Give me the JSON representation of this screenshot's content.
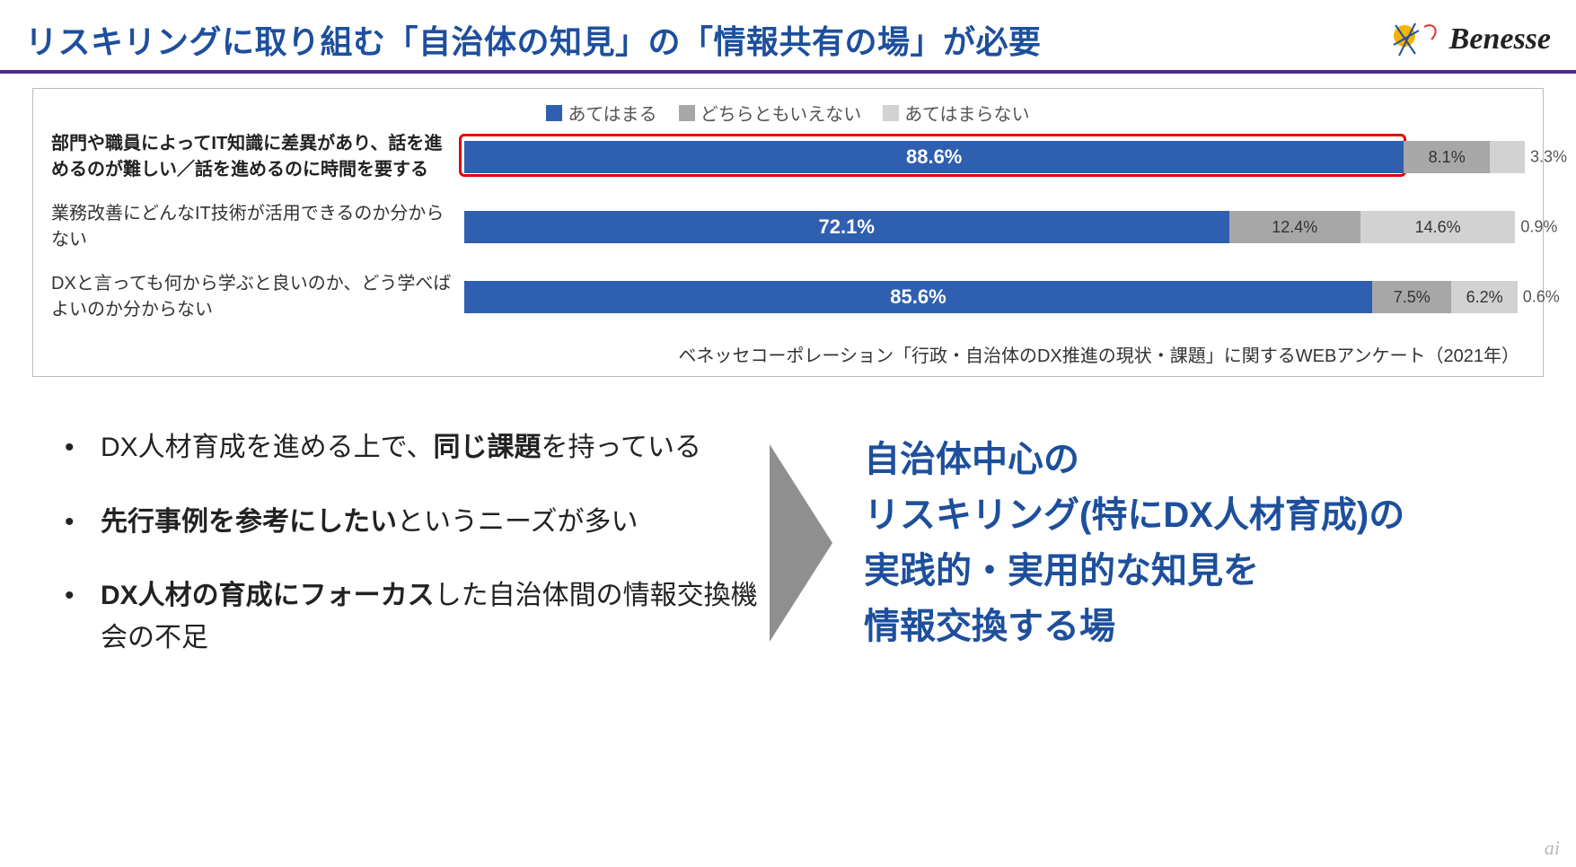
{
  "header": {
    "title": "リスキリングに取り組む「自治体の知見」の「情報共有の場」が必要",
    "brand": "Benesse"
  },
  "chart_data": {
    "type": "bar",
    "orientation": "horizontal-stacked",
    "unit": "%",
    "legend": [
      "あてはまる",
      "どちらともいえない",
      "あてはまらない"
    ],
    "categories": [
      "部門や職員によってIT知識に差異があり、話を進めるのが難しい／話を進めるのに時間を要する",
      "業務改善にどんなIT技術が活用できるのか分からない",
      "DXと言っても何から学ぶと良いのか、どう学べばよいのか分からない"
    ],
    "series": [
      {
        "name": "あてはまる",
        "values": [
          88.6,
          72.1,
          85.6
        ]
      },
      {
        "name": "どちらともいえない",
        "values": [
          8.1,
          12.4,
          7.5
        ]
      },
      {
        "name": "あてはまらない",
        "values": [
          3.3,
          14.6,
          6.2
        ]
      }
    ],
    "overflow_labels": [
      null,
      "0.9%",
      "0.6%"
    ],
    "highlighted_row_index": 0,
    "source": "ベネッセコーポレーション「行政・自治体のDX推進の現状・課題」に関するWEBアンケート（2021年）"
  },
  "bullets": [
    {
      "pre": "DX人材育成を進める上で、",
      "bold": "同じ課題",
      "post": "を持っている"
    },
    {
      "pre": "",
      "bold": "先行事例を参考にしたい",
      "post": "というニーズが多い"
    },
    {
      "pre": "",
      "bold": "DX人材の育成にフォーカス",
      "post": "した自治体間の情報交換機会の不足"
    }
  ],
  "conclusion": {
    "line1": "自治体中心の",
    "line2a": "リスキリング",
    "line2b": "(特にDX人材育成)の",
    "line3": "実践的・実用的な知見を",
    "line4": "情報交換する場"
  },
  "watermark": "ai"
}
